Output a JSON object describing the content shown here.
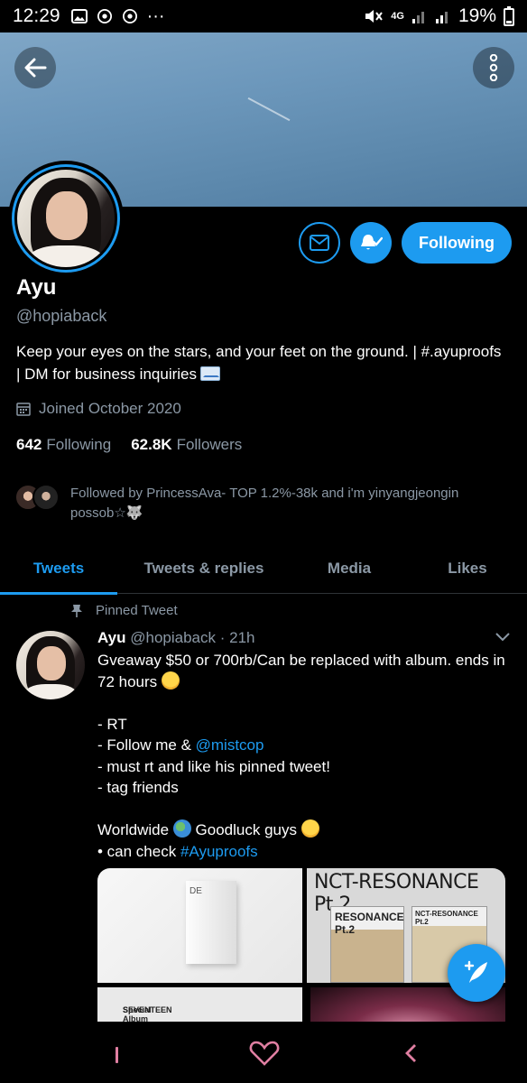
{
  "status_bar": {
    "time": "12:29",
    "network": "4G",
    "battery": "19%",
    "overflow": "···"
  },
  "profile": {
    "name": "Ayu",
    "handle": "@hopiaback",
    "bio": "Keep your eyes on the stars, and your feet on the ground. | #.ayuproofs | DM for business inquiries",
    "joined": "Joined October 2020",
    "following_count": "642",
    "following_label": "Following",
    "followers_count": "62.8K",
    "followers_label": "Followers",
    "followed_by": "Followed by PrincessAva- TOP 1.2%-38k and i'm yinyangjeongin possob☆🐺",
    "follow_button_label": "Following"
  },
  "tabs": [
    {
      "label": "Tweets",
      "active": true
    },
    {
      "label": "Tweets & replies",
      "active": false
    },
    {
      "label": "Media",
      "active": false
    },
    {
      "label": "Likes",
      "active": false
    }
  ],
  "tweet": {
    "pinned_label": "Pinned Tweet",
    "author_name": "Ayu",
    "author_handle": "@hopiaback",
    "time": "· 21h",
    "line1": "Gveaway $50 or 700rb/Can be replaced with album. ends in 72 hours",
    "line_rt": "- RT",
    "line_follow_prefix": "- Follow me & ",
    "mention": "@mistcop",
    "line_must": "- must rt and like his pinned tweet!",
    "line_tag": "- tag friends",
    "line_worldwide_a": "Worldwide",
    "line_worldwide_b": "Goodluck guys",
    "line_check_prefix": " • can check ",
    "hashtag": "#Ayuproofs"
  },
  "media": {
    "m1_caption": "DE",
    "m2_title": "NCT-RESONANCE Pt.2",
    "m2_album1": "RESONANCE Pt.2",
    "m2_album2": "NCT-RESONANCE Pt.2",
    "m3_caption_line1": "SEVENTEEN",
    "m3_caption_line2": "Special Album"
  },
  "colors": {
    "accent": "#1d9bf0",
    "background": "#000000",
    "secondary_text": "#8b98a5",
    "nav_pink": "#e07fa2"
  },
  "icons": {
    "back": "arrow-left-icon",
    "more": "more-vertical-icon",
    "message": "envelope-icon",
    "bell": "bell-icon",
    "calendar": "calendar-icon",
    "pin": "pin-icon",
    "chevron": "chevron-down-icon",
    "compose": "compose-tweet-icon"
  }
}
